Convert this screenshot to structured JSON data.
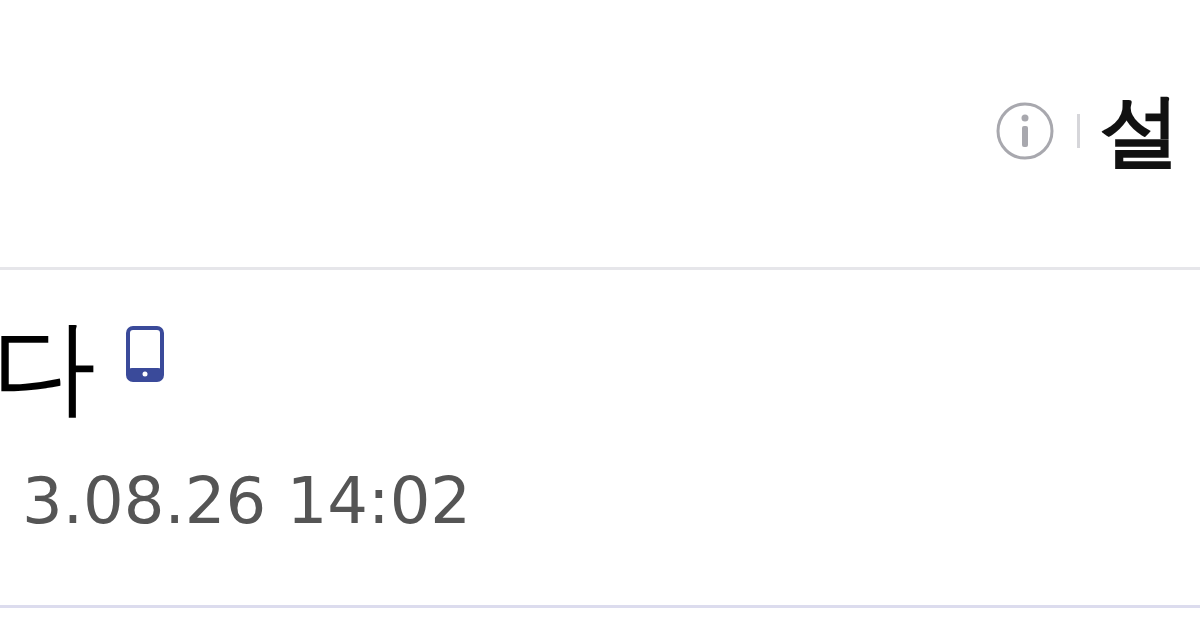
{
  "header": {
    "title": "설"
  },
  "post": {
    "title": "다",
    "date": "3.08.26 14:02"
  }
}
